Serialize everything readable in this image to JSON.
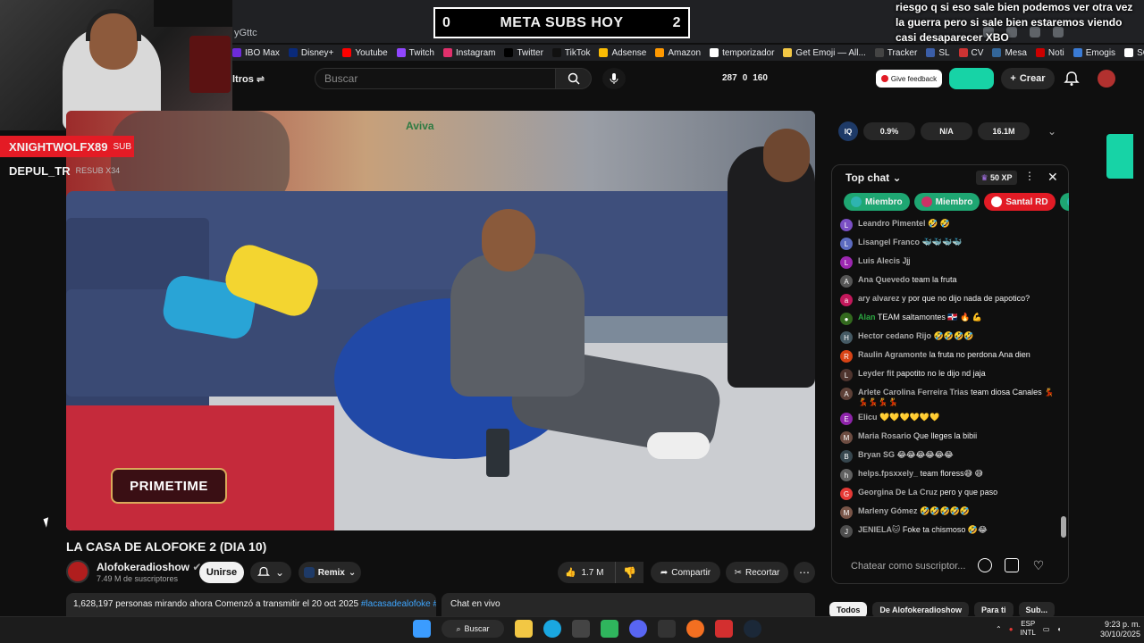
{
  "browser": {
    "url_fragment": "yGttc",
    "bookmarks": [
      {
        "label": "IBO Max",
        "color": "#6d2bd9",
        "icon": "hbo-icon"
      },
      {
        "label": "Disney+",
        "color": "#0a2a7a",
        "icon": "disney-icon"
      },
      {
        "label": "Youtube",
        "color": "#ff0000",
        "icon": "youtube-icon"
      },
      {
        "label": "Twitch",
        "color": "#9146ff",
        "icon": "twitch-icon"
      },
      {
        "label": "Instagram",
        "color": "#e1306c",
        "icon": "instagram-icon"
      },
      {
        "label": "Twitter",
        "color": "#000000",
        "icon": "x-icon"
      },
      {
        "label": "TikTok",
        "color": "#111111",
        "icon": "tiktok-icon"
      },
      {
        "label": "Adsense",
        "color": "#fbbc04",
        "icon": "adsense-icon"
      },
      {
        "label": "Amazon",
        "color": "#ff9900",
        "icon": "amazon-icon"
      },
      {
        "label": "temporizador",
        "color": "#ffffff",
        "icon": "clock-icon"
      },
      {
        "label": "Get Emoji — All...",
        "color": "#f2c744",
        "icon": "emoji-icon"
      },
      {
        "label": "Tracker",
        "color": "#444444",
        "icon": "tracker-icon"
      },
      {
        "label": "SL",
        "color": "#3b5ea8",
        "icon": "sl-icon"
      },
      {
        "label": "CV",
        "color": "#cc3333",
        "icon": "cv-icon"
      },
      {
        "label": "Mesa",
        "color": "#336699",
        "icon": "mesa-icon"
      },
      {
        "label": "Noti",
        "color": "#cc0000",
        "icon": "news-icon"
      },
      {
        "label": "Emogis",
        "color": "#3a7bd5",
        "icon": "emoji-icon"
      },
      {
        "label": "SORTEO PICKER",
        "color": "#ffffff",
        "icon": "picker-icon"
      }
    ]
  },
  "overlay": {
    "meta_left": "0",
    "meta_title": "META SUBS HOY",
    "meta_right": "2",
    "alert": "riesgo q si eso sale bien podemos ver otra vez la guerra pero si sale bien estaremos viendo casi desaparecer XBO",
    "sub_name": "XNIGHTWOLFX89",
    "sub_label": "SUB",
    "resub_name": "DEPUL_TR",
    "resub_label": "RESUB X34"
  },
  "header": {
    "filters_label": "ltros",
    "search_placeholder": "Buscar",
    "stats": [
      "287",
      "0",
      "160"
    ],
    "feedback_label": "Give feedback",
    "create_label": "Crear"
  },
  "video": {
    "primetime_label": "PRIMETIME",
    "sign_label": "Aviva",
    "title": "LA CASA DE ALOFOKE 2 (DIA 10)",
    "channel_name": "Alofokeradioshow",
    "channel_subs": "7.49 M de suscriptores",
    "join_label": "Unirse",
    "remix_label": "Remix",
    "likes": "1.7 M",
    "share_label": "Compartir",
    "clip_label": "Recortar",
    "description": "1,628,197 personas mirando ahora  Comenzó a transmitir el 20 oct 2025 ",
    "description_tag": "#lacasadealofoke #al",
    "live_chat_label": "Chat en vivo"
  },
  "iq": {
    "logo": "IQ",
    "pills": [
      "0.9%",
      "N/A",
      "16.1M"
    ]
  },
  "chat": {
    "title": "Top chat",
    "xp": "50 XP",
    "chips": [
      {
        "label": "Miembro",
        "color": "#1ea672",
        "ico": "#2eb4b0"
      },
      {
        "label": "Miembro",
        "color": "#1ea672",
        "ico": "#cc3366"
      },
      {
        "label": "Santal RD",
        "color": "#e21b25",
        "ico": "#ffffff"
      },
      {
        "label": "A",
        "color": "#1ea672",
        "ico": "#2eb4b0"
      }
    ],
    "messages": [
      {
        "initial": "L",
        "color": "#7a4fc4",
        "author": "Leandro Pimentel",
        "text": "🤣 🤣"
      },
      {
        "initial": "L",
        "color": "#5c6bc0",
        "author": "Lisangel Franco",
        "text": "🐳🐳🐳🐳"
      },
      {
        "initial": "L",
        "color": "#9c27b0",
        "author": "Luis Alecis",
        "text": "Jjj"
      },
      {
        "initial": "A",
        "color": "#555555",
        "author": "Ana Quevedo",
        "text": "team la fruta"
      },
      {
        "initial": "a",
        "color": "#c2185b",
        "author": "ary alvarez",
        "text": "y por que no dijo nada de papotico?"
      },
      {
        "initial": "●",
        "color": "#33691e",
        "author": "Alan",
        "text": "TEAM saltamontes 🇩🇴 🔥 💪",
        "green": true
      },
      {
        "initial": "H",
        "color": "#455a64",
        "author": "Hector cedano Rijo",
        "text": "🤣🤣🤣🤣"
      },
      {
        "initial": "R",
        "color": "#d84315",
        "author": "Raulin Agramonte",
        "text": "la fruta no perdona Ana dien"
      },
      {
        "initial": "L",
        "color": "#4e342e",
        "author": "Leyder fit",
        "text": "papotito no le dijo nd jaja"
      },
      {
        "initial": "A",
        "color": "#5d4037",
        "author": "Arlete Carolina Ferreira Trias",
        "text": "team diosa Canales 💃💃💃💃💃"
      },
      {
        "initial": "E",
        "color": "#8e24aa",
        "author": "Elicu",
        "text": "💛💛💛💛💛💛"
      },
      {
        "initial": "M",
        "color": "#6d4c41",
        "author": "Maria Rosario",
        "text": "Que lleges la bibii"
      },
      {
        "initial": "B",
        "color": "#37474f",
        "author": "Bryan SG",
        "text": "😂😂😂😂😂😂"
      },
      {
        "initial": "h",
        "color": "#616161",
        "author": "helps.fpsxxely_",
        "text": "team floress😅 😅"
      },
      {
        "initial": "G",
        "color": "#e53935",
        "author": "Georgina De La Cruz",
        "text": "pero y que paso"
      },
      {
        "initial": "M",
        "color": "#795548",
        "author": "Marleny Gómez",
        "text": "🤣🤣🤣🤣🤣"
      },
      {
        "initial": "J",
        "color": "#4e4e4e",
        "author": "JENIELA🐱",
        "text": "Foke ta chismoso 🤣😂"
      }
    ],
    "input_placeholder": "Chatear como suscriptor...",
    "tabs": [
      "Todos",
      "De Alofokeradioshow",
      "Para ti",
      "Sub..."
    ]
  },
  "taskbar": {
    "search_label": "Buscar",
    "lang_top": "ESP",
    "lang_bottom": "INTL",
    "time": "9:23 p. m.",
    "date": "30/10/2025"
  }
}
